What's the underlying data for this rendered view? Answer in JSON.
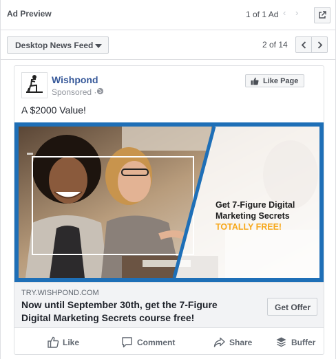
{
  "header": {
    "title": "Ad Preview",
    "ad_count": "1 of 1 Ad"
  },
  "toolbar": {
    "placement": "Desktop News Feed",
    "page_indicator": "2 of 14"
  },
  "post": {
    "page_name": "Wishpond",
    "sponsored": "Sponsored ·",
    "like_page": "Like Page",
    "body_text": "A $2000 Value!",
    "image": {
      "headline_line1": "Get 7-Figure Digital",
      "headline_line2": "Marketing Secrets",
      "headline_accent": "TOTALLY FREE!"
    },
    "link": {
      "domain": "TRY.WISHPOND.COM",
      "headline": "Now until September 30th, get the 7-Figure Digital Marketing Secrets course free!",
      "cta": "Get Offer"
    },
    "actions": {
      "like": "Like",
      "comment": "Comment",
      "share": "Share",
      "buffer": "Buffer"
    }
  },
  "colors": {
    "brand_link": "#365899",
    "accent_orange": "#f7a81b",
    "image_frame_blue": "#1e6fb7"
  }
}
